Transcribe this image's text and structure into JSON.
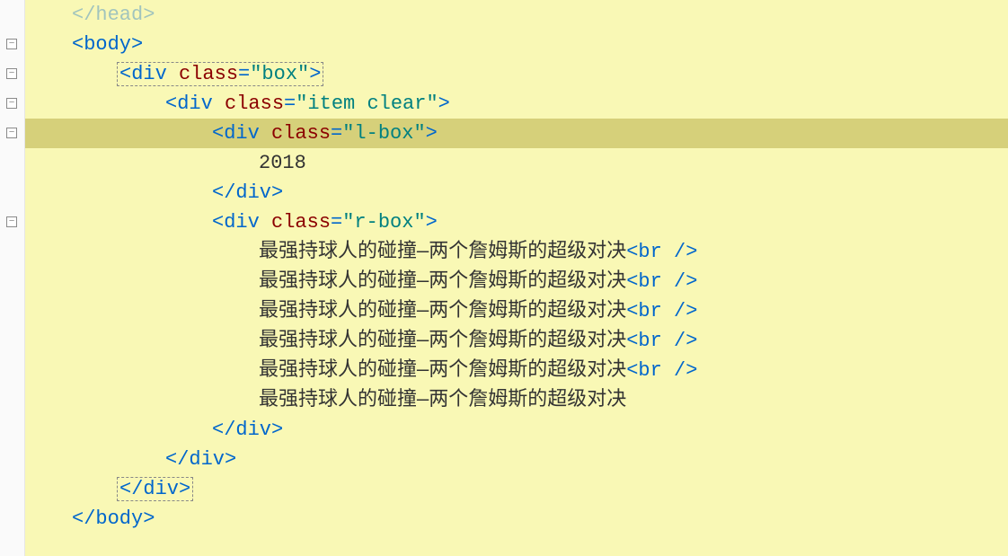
{
  "gutter": {
    "fold_glyph": "−",
    "marks_at_lines": [
      1,
      2,
      3,
      4,
      8
    ]
  },
  "code": {
    "tags": {
      "head_close": "</head>",
      "body_open": "<body>",
      "body_close": "</body>",
      "div_open": "<div",
      "div_close": "</div>",
      "br": "<br />"
    },
    "attrs": {
      "class": "class"
    },
    "eq": "=",
    "gt": ">",
    "class_values": {
      "box": "\"box\"",
      "item_clear": "\"item clear\"",
      "l_box": "\"l-box\"",
      "r_box": "\"r-box\""
    },
    "text": {
      "year": "2018",
      "content_line": "最强持球人的碰撞—两个詹姆斯的超级对决"
    }
  }
}
